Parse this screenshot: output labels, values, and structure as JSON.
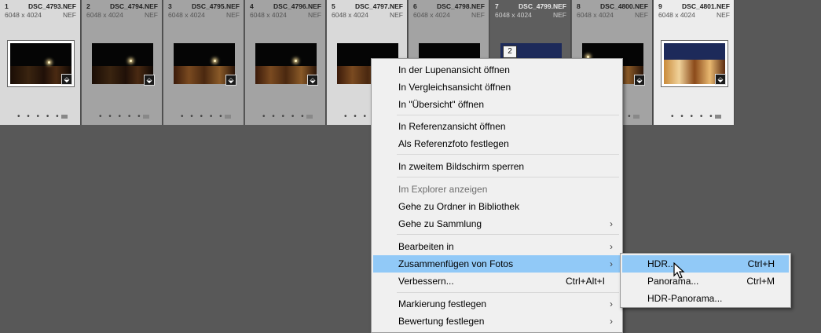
{
  "filmstrip": {
    "cells": [
      {
        "num": "1",
        "file": "DSC_4793.NEF",
        "dims": "6048 x 4024",
        "ext": "NEF"
      },
      {
        "num": "2",
        "file": "DSC_4794.NEF",
        "dims": "6048 x 4024",
        "ext": "NEF"
      },
      {
        "num": "3",
        "file": "DSC_4795.NEF",
        "dims": "6048 x 4024",
        "ext": "NEF"
      },
      {
        "num": "4",
        "file": "DSC_4796.NEF",
        "dims": "6048 x 4024",
        "ext": "NEF"
      },
      {
        "num": "5",
        "file": "DSC_4797.NEF",
        "dims": "6048 x 4024",
        "ext": "NEF"
      },
      {
        "num": "6",
        "file": "DSC_4798.NEF",
        "dims": "6048 x 4024",
        "ext": "NEF"
      },
      {
        "num": "7",
        "file": "DSC_4799.NEF",
        "dims": "6048 x 4024",
        "ext": "NEF"
      },
      {
        "num": "8",
        "file": "DSC_4800.NEF",
        "dims": "6048 x 4024",
        "ext": "NEF"
      },
      {
        "num": "9",
        "file": "DSC_4801.NEF",
        "dims": "6048 x 4024",
        "ext": "NEF"
      }
    ],
    "rating_dots": "• • • • •",
    "stack_count": "2"
  },
  "context_menu": {
    "items": [
      {
        "label": "In der Lupenansicht öffnen"
      },
      {
        "label": "In Vergleichsansicht öffnen"
      },
      {
        "label": "In \"Übersicht\" öffnen"
      },
      {
        "label": "In Referenzansicht öffnen"
      },
      {
        "label": "Als Referenzfoto festlegen"
      },
      {
        "label": "In zweitem Bildschirm sperren"
      },
      {
        "label": "Im Explorer anzeigen"
      },
      {
        "label": "Gehe zu Ordner in Bibliothek"
      },
      {
        "label": "Gehe zu Sammlung"
      },
      {
        "label": "Bearbeiten in"
      },
      {
        "label": "Zusammenfügen von Fotos"
      },
      {
        "label": "Verbessern...",
        "shortcut": "Ctrl+Alt+I"
      },
      {
        "label": "Markierung festlegen"
      },
      {
        "label": "Bewertung festlegen"
      }
    ],
    "submenu_arrow": "›"
  },
  "submenu": {
    "items": [
      {
        "label": "HDR...",
        "shortcut": "Ctrl+H"
      },
      {
        "label": "Panorama...",
        "shortcut": "Ctrl+M"
      },
      {
        "label": "HDR-Panorama..."
      }
    ]
  },
  "colors": {
    "highlight": "#91c9f7",
    "background": "#585858"
  }
}
